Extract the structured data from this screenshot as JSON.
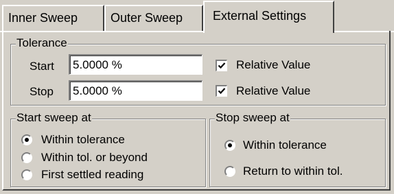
{
  "tabs": [
    {
      "label": "Inner Sweep",
      "selected": false
    },
    {
      "label": "Outer Sweep",
      "selected": false
    },
    {
      "label": "External Settings",
      "selected": true
    }
  ],
  "tolerance": {
    "title": "Tolerance",
    "start_label": "Start",
    "start_value": "5.0000 %",
    "stop_label": "Stop",
    "stop_value": "5.0000 %",
    "start_relative": {
      "label": "Relative Value",
      "checked": true
    },
    "stop_relative": {
      "label": "Relative Value",
      "checked": true
    }
  },
  "start_sweep": {
    "title": "Start sweep at",
    "options": [
      {
        "label": "Within tolerance",
        "selected": true
      },
      {
        "label": "Within tol. or beyond",
        "selected": false
      },
      {
        "label": "First settled reading",
        "selected": false
      }
    ]
  },
  "stop_sweep": {
    "title": "Stop sweep at",
    "options": [
      {
        "label": "Within tolerance",
        "selected": true
      },
      {
        "label": "Return to within tol.",
        "selected": false
      }
    ]
  }
}
